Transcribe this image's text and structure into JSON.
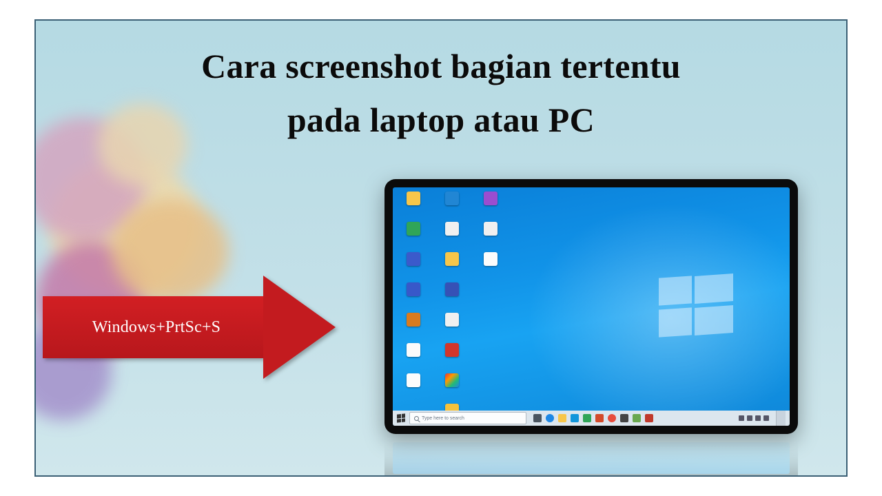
{
  "title": {
    "line1": "Cara screenshot bagian tertentu",
    "line2": "pada laptop atau PC"
  },
  "arrow": {
    "text": "Windows+PrtSc+S"
  },
  "desktop": {
    "taskbar": {
      "search_placeholder": "Type here to search"
    }
  }
}
